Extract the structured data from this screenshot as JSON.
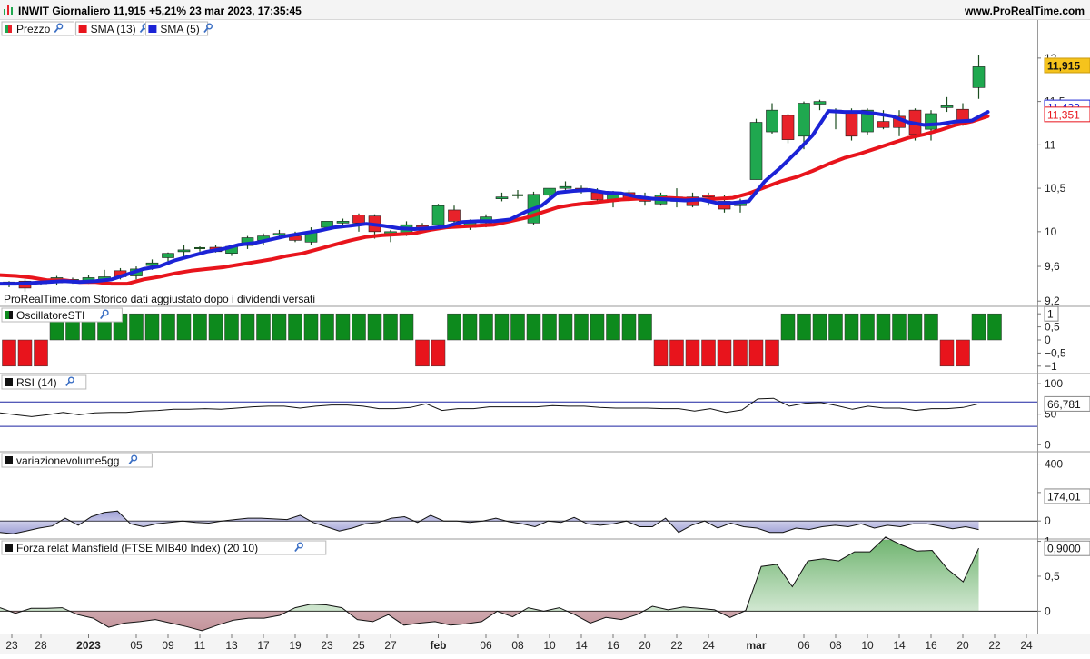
{
  "header": {
    "title": "INWIT Giornaliero 11,915 +5,21% 23 mar 2023, 17:35:45",
    "site": "www.ProRealTime.com"
  },
  "colors": {
    "bull": "#1fa84f",
    "bear": "#e8222a",
    "sma13": "#e8141c",
    "sma5": "#1b23d6",
    "sti_bull": "#0d8a1d",
    "sti_bear": "#e8141c"
  },
  "chart_data": [
    {
      "id": "price",
      "type": "candlestick",
      "legend": [
        {
          "label": "Prezzo",
          "icon": "candle-icon"
        },
        {
          "label": "SMA (13)",
          "color": "#e8141c"
        },
        {
          "label": "SMA (5)",
          "color": "#1b23d6"
        }
      ],
      "note": "ProRealTime.com  Storico dati aggiustato dopo i dividendi versati",
      "ylim": [
        9.15,
        12.25
      ],
      "yticks": [
        {
          "v": 12,
          "label": "12"
        },
        {
          "v": 11.5,
          "label": "11,5"
        },
        {
          "v": 11,
          "label": "11"
        },
        {
          "v": 10.5,
          "label": "10,5"
        },
        {
          "v": 10,
          "label": "10"
        },
        {
          "v": 9.6,
          "label": "9,6"
        },
        {
          "v": 9.2,
          "label": "9,2"
        }
      ],
      "tags": [
        {
          "v": 11.915,
          "label": "11,915",
          "style": "price"
        },
        {
          "v": 11.432,
          "label": "11,432",
          "style": "sma5"
        },
        {
          "v": 11.351,
          "label": "11,351",
          "style": "sma13"
        }
      ],
      "ohlc": [
        [
          9.4,
          9.43,
          9.36,
          9.42
        ],
        [
          9.43,
          9.45,
          9.31,
          9.35
        ],
        [
          9.4,
          9.44,
          9.38,
          9.42
        ],
        [
          9.41,
          9.49,
          9.38,
          9.47
        ],
        [
          9.44,
          9.47,
          9.4,
          9.45
        ],
        [
          9.43,
          9.5,
          9.4,
          9.47
        ],
        [
          9.44,
          9.56,
          9.42,
          9.48
        ],
        [
          9.55,
          9.58,
          9.45,
          9.48
        ],
        [
          9.49,
          9.6,
          9.45,
          9.57
        ],
        [
          9.61,
          9.68,
          9.56,
          9.64
        ],
        [
          9.7,
          9.76,
          9.66,
          9.75
        ],
        [
          9.78,
          9.85,
          9.71,
          9.79
        ],
        [
          9.81,
          9.83,
          9.77,
          9.81
        ],
        [
          9.82,
          9.85,
          9.76,
          9.77
        ],
        [
          9.75,
          9.84,
          9.72,
          9.83
        ],
        [
          9.84,
          9.95,
          9.8,
          9.93
        ],
        [
          9.9,
          9.98,
          9.85,
          9.95
        ],
        [
          9.96,
          10.02,
          9.92,
          9.98
        ],
        [
          9.95,
          10.0,
          9.88,
          9.9
        ],
        [
          9.88,
          10.05,
          9.85,
          10.0
        ],
        [
          10.05,
          10.1,
          10.02,
          10.12
        ],
        [
          10.1,
          10.15,
          10.07,
          10.12
        ],
        [
          10.19,
          10.21,
          10.0,
          10.1
        ],
        [
          10.18,
          10.2,
          9.92,
          10.0
        ],
        [
          9.98,
          10.02,
          9.88,
          10.0
        ],
        [
          9.96,
          10.12,
          9.95,
          10.08
        ],
        [
          10.07,
          10.1,
          10.02,
          10.06
        ],
        [
          10.08,
          10.32,
          10.06,
          10.3
        ],
        [
          10.25,
          10.3,
          10.06,
          10.12
        ],
        [
          10.05,
          10.14,
          10.02,
          10.11
        ],
        [
          10.1,
          10.2,
          10.05,
          10.17
        ],
        [
          10.38,
          10.45,
          10.35,
          10.4
        ],
        [
          10.42,
          10.48,
          10.38,
          10.42
        ],
        [
          10.1,
          10.46,
          10.08,
          10.43
        ],
        [
          10.42,
          10.5,
          10.38,
          10.5
        ],
        [
          10.5,
          10.58,
          10.45,
          10.52
        ],
        [
          10.5,
          10.53,
          10.44,
          10.47
        ],
        [
          10.45,
          10.5,
          10.34,
          10.37
        ],
        [
          10.35,
          10.47,
          10.28,
          10.45
        ],
        [
          10.45,
          10.48,
          10.35,
          10.38
        ],
        [
          10.38,
          10.45,
          10.3,
          10.35
        ],
        [
          10.32,
          10.45,
          10.3,
          10.42
        ],
        [
          10.4,
          10.5,
          10.28,
          10.35
        ],
        [
          10.4,
          10.45,
          10.28,
          10.3
        ],
        [
          10.42,
          10.45,
          10.3,
          10.4
        ],
        [
          10.35,
          10.42,
          10.22,
          10.26
        ],
        [
          10.3,
          10.38,
          10.22,
          10.35
        ],
        [
          10.6,
          11.3,
          10.6,
          11.26
        ],
        [
          11.15,
          11.48,
          11.13,
          11.4
        ],
        [
          11.34,
          11.36,
          11.02,
          11.06
        ],
        [
          11.1,
          11.5,
          10.95,
          11.48
        ],
        [
          11.47,
          11.52,
          11.4,
          11.5
        ],
        [
          11.4,
          11.42,
          11.18,
          11.38
        ],
        [
          11.38,
          11.42,
          11.05,
          11.1
        ],
        [
          11.15,
          11.42,
          11.12,
          11.4
        ],
        [
          11.27,
          11.4,
          11.18,
          11.2
        ],
        [
          11.33,
          11.4,
          11.1,
          11.2
        ],
        [
          11.4,
          11.42,
          11.05,
          11.12
        ],
        [
          11.18,
          11.4,
          11.05,
          11.36
        ],
        [
          11.44,
          11.55,
          11.38,
          11.45
        ],
        [
          11.41,
          11.48,
          11.22,
          11.25
        ],
        [
          11.66,
          12.03,
          11.53,
          11.9
        ]
      ],
      "sma13": [
        9.5,
        9.49,
        9.47,
        9.44,
        9.44,
        9.42,
        9.42,
        9.4,
        9.4,
        9.45,
        9.48,
        9.52,
        9.55,
        9.57,
        9.59,
        9.62,
        9.65,
        9.68,
        9.72,
        9.75,
        9.8,
        9.85,
        9.9,
        9.94,
        9.96,
        9.97,
        9.98,
        10.02,
        10.05,
        10.06,
        10.07,
        10.08,
        10.12,
        10.16,
        10.22,
        10.28,
        10.31,
        10.33,
        10.35,
        10.37,
        10.38,
        10.38,
        10.39,
        10.38,
        10.37,
        10.38,
        10.39,
        10.44,
        10.51,
        10.58,
        10.63,
        10.7,
        10.78,
        10.85,
        10.9,
        10.96,
        11.02,
        11.08,
        11.12,
        11.17,
        11.23,
        11.27,
        11.33
      ],
      "sma5": [
        9.4,
        9.4,
        9.41,
        9.42,
        9.43,
        9.42,
        9.43,
        9.45,
        9.51,
        9.57,
        9.6,
        9.67,
        9.72,
        9.77,
        9.8,
        9.85,
        9.87,
        9.91,
        9.95,
        9.98,
        10.01,
        10.05,
        10.07,
        10.09,
        10.07,
        10.04,
        10.03,
        10.04,
        10.06,
        10.11,
        10.12,
        10.12,
        10.14,
        10.23,
        10.3,
        10.45,
        10.47,
        10.48,
        10.45,
        10.44,
        10.4,
        10.38,
        10.37,
        10.36,
        10.37,
        10.33,
        10.33,
        10.35,
        10.58,
        10.74,
        10.92,
        11.11,
        11.39,
        11.38,
        11.38,
        11.36,
        11.33,
        11.26,
        11.23,
        11.24,
        11.27,
        11.28,
        11.38
      ]
    },
    {
      "id": "sti",
      "type": "histogram",
      "legend": [
        {
          "label": "OscillatoreSTI",
          "icon": "osc-icon"
        }
      ],
      "ylim": [
        -1.25,
        1.25
      ],
      "yticks": [
        {
          "v": 1,
          "label": "1"
        },
        {
          "v": 0.5,
          "label": "0,5"
        },
        {
          "v": 0,
          "label": "0"
        },
        {
          "v": -0.5,
          "label": "−0,5"
        },
        {
          "v": -1,
          "label": "−1"
        }
      ],
      "tags": [
        {
          "v": 1,
          "label": "1"
        }
      ],
      "values": [
        -1,
        -1,
        -1,
        1,
        1,
        1,
        1,
        1,
        1,
        1,
        1,
        1,
        1,
        1,
        1,
        1,
        1,
        1,
        1,
        1,
        1,
        1,
        1,
        1,
        1,
        1,
        -1,
        -1,
        1,
        1,
        1,
        1,
        1,
        1,
        1,
        1,
        1,
        1,
        1,
        1,
        1,
        -1,
        -1,
        -1,
        -1,
        -1,
        -1,
        -1,
        -1,
        1,
        1,
        1,
        1,
        1,
        1,
        1,
        1,
        1,
        1,
        -1,
        -1,
        1,
        1
      ]
    },
    {
      "id": "rsi",
      "type": "line",
      "legend": [
        {
          "label": "RSI (14)",
          "icon": "indicator-icon"
        }
      ],
      "ylim": [
        -10,
        115
      ],
      "yticks": [
        {
          "v": 100,
          "label": "100"
        },
        {
          "v": 50,
          "label": "50"
        },
        {
          "v": 0,
          "label": "0"
        }
      ],
      "levels": [
        70,
        30
      ],
      "tags": [
        {
          "v": 66.781,
          "label": "66,781"
        }
      ],
      "values": [
        52,
        49,
        46,
        49,
        53,
        49,
        52,
        53,
        53,
        55,
        56,
        58,
        58,
        59,
        58,
        60,
        62,
        63,
        63,
        60,
        63,
        65,
        65,
        63,
        59,
        59,
        61,
        67,
        56,
        59,
        59,
        62,
        62,
        62,
        62,
        64,
        63,
        63,
        61,
        60,
        60,
        60,
        59,
        59,
        55,
        59,
        53,
        57,
        75,
        76,
        63,
        68,
        69,
        64,
        58,
        63,
        60,
        60,
        56,
        59,
        59,
        61,
        67
      ]
    },
    {
      "id": "volume",
      "type": "area",
      "legend": [
        {
          "label": "variazionevolume5gg",
          "icon": "indicator-icon"
        }
      ],
      "ylim": [
        -120,
        480
      ],
      "yticks": [
        {
          "v": 400,
          "label": "400"
        },
        {
          "v": 200,
          "label": "200"
        },
        {
          "v": 0,
          "label": "0"
        }
      ],
      "tags": [
        {
          "v": 174.01,
          "label": "174,01"
        }
      ],
      "values": [
        -80,
        -90,
        -70,
        -50,
        -35,
        20,
        -30,
        30,
        60,
        70,
        -20,
        -40,
        -20,
        -10,
        0,
        -10,
        -15,
        0,
        10,
        20,
        20,
        15,
        10,
        40,
        -10,
        -40,
        -70,
        -50,
        -20,
        -10,
        20,
        30,
        -10,
        40,
        0,
        0,
        -10,
        0,
        20,
        -5,
        -20,
        -40,
        0,
        -10,
        25,
        -20,
        -30,
        -20,
        0,
        -40,
        -40,
        20,
        -80,
        -30,
        0,
        -50,
        -15,
        -40,
        -50,
        -80,
        -80,
        -50,
        -60,
        -40,
        -30,
        -40,
        -20,
        -50,
        -30,
        -40,
        -20,
        -20,
        -35,
        -55,
        -40,
        -60
      ]
    },
    {
      "id": "mansfield",
      "type": "area",
      "legend": [
        {
          "label": "Forza relat Mansfield (FTSE MIB40 Index) (20 10)",
          "icon": "indicator-icon"
        }
      ],
      "ylim": [
        -0.32,
        1.02
      ],
      "yticks": [
        {
          "v": 1,
          "label": "1"
        },
        {
          "v": 0.5,
          "label": "0,5"
        },
        {
          "v": 0,
          "label": "0"
        }
      ],
      "tags": [
        {
          "v": 0.9,
          "label": "0,9000"
        }
      ],
      "values": [
        0.05,
        -0.03,
        0.04,
        0.04,
        0.05,
        -0.05,
        -0.1,
        -0.23,
        -0.17,
        -0.15,
        -0.12,
        -0.17,
        -0.22,
        -0.28,
        -0.2,
        -0.13,
        -0.1,
        -0.1,
        -0.06,
        0.05,
        0.1,
        0.09,
        0.05,
        -0.12,
        -0.15,
        -0.05,
        -0.2,
        -0.17,
        -0.15,
        -0.2,
        -0.18,
        -0.15,
        0,
        -0.08,
        0.05,
        0,
        0.05,
        -0.05,
        -0.17,
        -0.09,
        -0.12,
        -0.05,
        0.07,
        0.02,
        0.06,
        0.04,
        0.02,
        -0.09,
        0.01,
        0.64,
        0.67,
        0.35,
        0.72,
        0.75,
        0.72,
        0.85,
        0.85,
        1.06,
        0.95,
        0.86,
        0.87,
        0.6,
        0.42,
        0.9
      ]
    }
  ],
  "xaxis": {
    "ticks": [
      {
        "i": 0,
        "label": "23"
      },
      {
        "i": 2,
        "label": "28"
      },
      {
        "i": 5,
        "label": "2023",
        "bold": true
      },
      {
        "i": 8,
        "label": "05"
      },
      {
        "i": 10,
        "label": "09"
      },
      {
        "i": 12,
        "label": "11"
      },
      {
        "i": 14,
        "label": "13"
      },
      {
        "i": 16,
        "label": "17"
      },
      {
        "i": 18,
        "label": "19"
      },
      {
        "i": 20,
        "label": "23"
      },
      {
        "i": 22,
        "label": "25"
      },
      {
        "i": 24,
        "label": "27"
      },
      {
        "i": 27,
        "label": "feb",
        "bold": true
      },
      {
        "i": 30,
        "label": "06"
      },
      {
        "i": 32,
        "label": "08"
      },
      {
        "i": 34,
        "label": "10"
      },
      {
        "i": 36,
        "label": "14"
      },
      {
        "i": 38,
        "label": "16"
      },
      {
        "i": 40,
        "label": "20"
      },
      {
        "i": 42,
        "label": "22"
      },
      {
        "i": 44,
        "label": "24"
      },
      {
        "i": 47,
        "label": "mar",
        "bold": true
      },
      {
        "i": 50,
        "label": "06"
      },
      {
        "i": 52,
        "label": "08"
      },
      {
        "i": 54,
        "label": "10"
      },
      {
        "i": 56,
        "label": "14"
      },
      {
        "i": 58,
        "label": "16"
      },
      {
        "i": 60,
        "label": "20"
      },
      {
        "i": 62,
        "label": "22"
      },
      {
        "i": 64,
        "label": "24"
      }
    ]
  }
}
